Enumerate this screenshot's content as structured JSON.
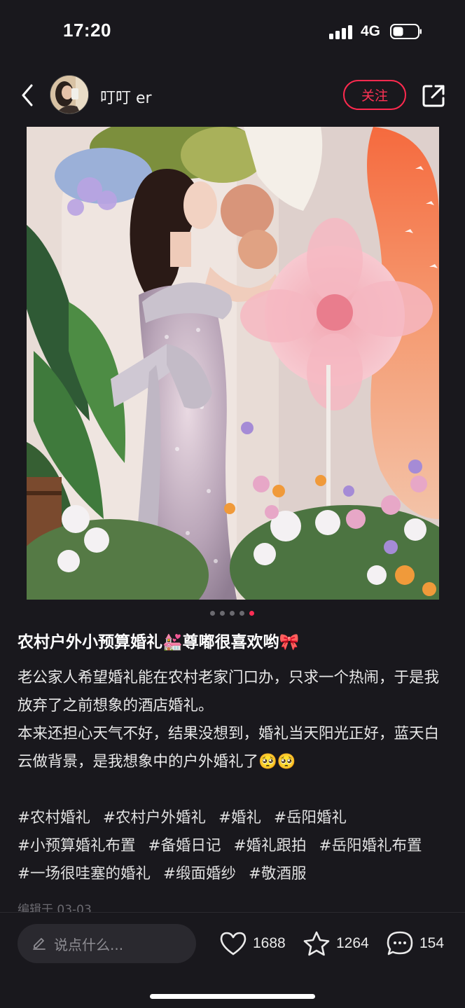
{
  "status_bar": {
    "time": "17:20",
    "network": "4G"
  },
  "header": {
    "author_name": "叮叮 er",
    "follow_label": "关注"
  },
  "carousel": {
    "total": 5,
    "active_index": 4
  },
  "post": {
    "title": "农村户外小预算婚礼💒尊嘟很喜欢哟🎀",
    "body_lines": [
      "老公家人希望婚礼能在农村老家门口办，只求一个热闹，于是我放弃了之前想象的酒店婚礼。",
      "本来还担心天气不好，结果没想到，婚礼当天阳光正好，蓝天白云做背景，是我想象中的户外婚礼了🥺🥺"
    ],
    "tags": [
      "#农村婚礼",
      "#农村户外婚礼",
      "#婚礼",
      "#岳阳婚礼",
      "#小预算婚礼布置",
      "#备婚日记",
      "#婚礼跟拍",
      "#岳阳婚礼布置",
      "#一场很哇塞的婚礼",
      "#缎面婚纱",
      "#敬酒服"
    ],
    "edit_time": "编辑于 03-03"
  },
  "bottom_bar": {
    "comment_placeholder": "说点什么...",
    "likes": "1688",
    "favorites": "1264",
    "comments": "154"
  },
  "icons": {
    "back": "chevron-left-icon",
    "share": "share-icon",
    "like": "heart-icon",
    "favorite": "star-icon",
    "comment": "comment-icon",
    "pencil": "pencil-icon"
  },
  "colors": {
    "accent": "#ff2d55",
    "background": "#19181d"
  }
}
